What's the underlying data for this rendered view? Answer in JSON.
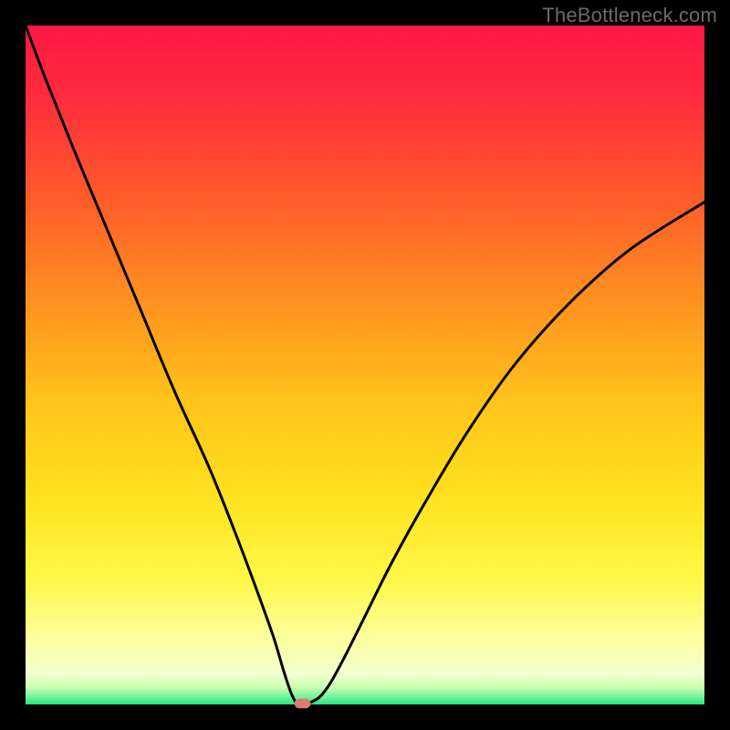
{
  "watermark": "TheBottleneck.com",
  "chart_data": {
    "type": "line",
    "title": "",
    "xlabel": "",
    "ylabel": "",
    "xlim": [
      0,
      100
    ],
    "ylim": [
      0,
      100
    ],
    "grid": false,
    "legend": false,
    "gradient_stops": [
      {
        "offset": 0.0,
        "color": "#ff1846"
      },
      {
        "offset": 0.1,
        "color": "#ff2a3e"
      },
      {
        "offset": 0.25,
        "color": "#ff5a2a"
      },
      {
        "offset": 0.4,
        "color": "#ff8f20"
      },
      {
        "offset": 0.55,
        "color": "#ffc21a"
      },
      {
        "offset": 0.7,
        "color": "#ffe320"
      },
      {
        "offset": 0.82,
        "color": "#fff84a"
      },
      {
        "offset": 0.9,
        "color": "#fdff9a"
      },
      {
        "offset": 0.955,
        "color": "#f4ffd0"
      },
      {
        "offset": 0.975,
        "color": "#c9ffb0"
      },
      {
        "offset": 0.99,
        "color": "#6cf29a"
      },
      {
        "offset": 1.0,
        "color": "#28e57a"
      }
    ],
    "series": [
      {
        "name": "bottleneck-curve",
        "x": [
          0.0,
          3.0,
          7.0,
          12.0,
          17.0,
          22.0,
          27.0,
          31.0,
          34.0,
          36.5,
          38.0,
          39.0,
          39.7,
          40.2,
          41.6,
          43.2,
          44.8,
          47.0,
          50.0,
          54.0,
          59.0,
          65.0,
          72.0,
          80.0,
          89.0,
          100.0
        ],
        "y": [
          100.0,
          92.0,
          82.0,
          70.0,
          58.0,
          46.0,
          35.0,
          25.0,
          17.0,
          10.0,
          5.0,
          2.0,
          0.5,
          0.2,
          0.2,
          1.0,
          3.0,
          7.0,
          13.0,
          21.0,
          30.0,
          40.0,
          50.0,
          59.0,
          67.0,
          74.0
        ],
        "color": "#000000"
      }
    ],
    "marker": {
      "x": 40.8,
      "y": 0.0,
      "color": "#e17870",
      "width": 2.4,
      "height": 1.4
    },
    "border_color": "#000000",
    "border_width_px": 10
  }
}
